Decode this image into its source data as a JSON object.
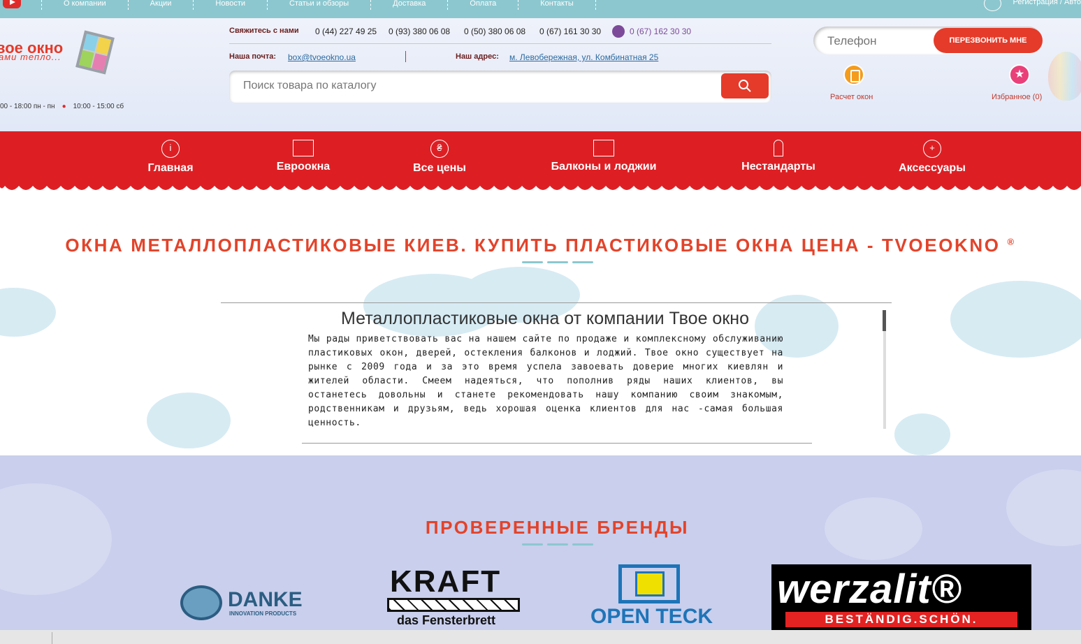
{
  "topbar": {
    "nav": [
      "О компании",
      "Акции",
      "Новости",
      "Статьи и обзоры",
      "Доставка",
      "Оплата",
      "Контакты"
    ],
    "register": "Регистрация / Авто"
  },
  "header": {
    "logo_text": "вое окно",
    "logo_sub": "ами тепло...",
    "hours": [
      "00 - 18:00 пн - пн",
      "10:00 - 15:00 сб"
    ],
    "contact_label": "Свяжитесь с нами",
    "phones": [
      "0 (44) 227 49 25",
      "0 (93) 380 06 08",
      "0 (50) 380 06 08",
      "0 (67) 161 30 30",
      "0 (67) 162 30 30"
    ],
    "mail_label": "Наша почта:",
    "mail": "box@tvoeokno.ua",
    "address_label": "Наш адрес:",
    "address": "м. Левобережная, ул. Комбинатная 25",
    "search_placeholder": "Поиск товара по каталогу",
    "phone_placeholder": "Телефон",
    "callback": "ПЕРЕЗВОНИТЬ МНЕ",
    "calc_label": "Расчет окон",
    "fav_label": "Избранное (0)"
  },
  "nav": [
    "Главная",
    "Евроокна",
    "Все цены",
    "Балконы и лоджии",
    "Нестандарты",
    "Аксессуары"
  ],
  "main": {
    "heading": "ОКНА МЕТАЛЛОПЛАСТИКОВЫЕ КИЕВ. КУПИТЬ ПЛАСТИКОВЫЕ ОКНА ЦЕНА - TVOEOKNO",
    "heading_mark": "®",
    "article_title": "Металлопластиковые окна от компании Твое окно",
    "article_body": "Мы рады приветствовать вас на нашем сайте по продаже и комплексному обслуживанию пластиковых окон, дверей, остекления балконов и лоджий. Твое окно существует на рынке с 2009 года и за это время успела завоевать доверие многих киевлян и жителей области. Смеем надеяться, что пополнив ряды наших клиентов, вы останетесь довольны и станете рекомендовать нашу компанию своим знакомым, родственникам и друзьям, ведь хорошая оценка клиентов для нас -самая большая ценность."
  },
  "brands": {
    "heading": "ПРОВЕРЕННЫЕ БРЕНДЫ",
    "danke": "DANKE",
    "danke_sub": "INNOVATION PRODUCTS",
    "kraft": "KRAFT",
    "kraft_sub": "das Fensterbrett",
    "openteck": "OPEN TECK",
    "werzalit": "werzalit®",
    "werzalit_sub": "BESTÄNDIG.SCHÖN."
  }
}
